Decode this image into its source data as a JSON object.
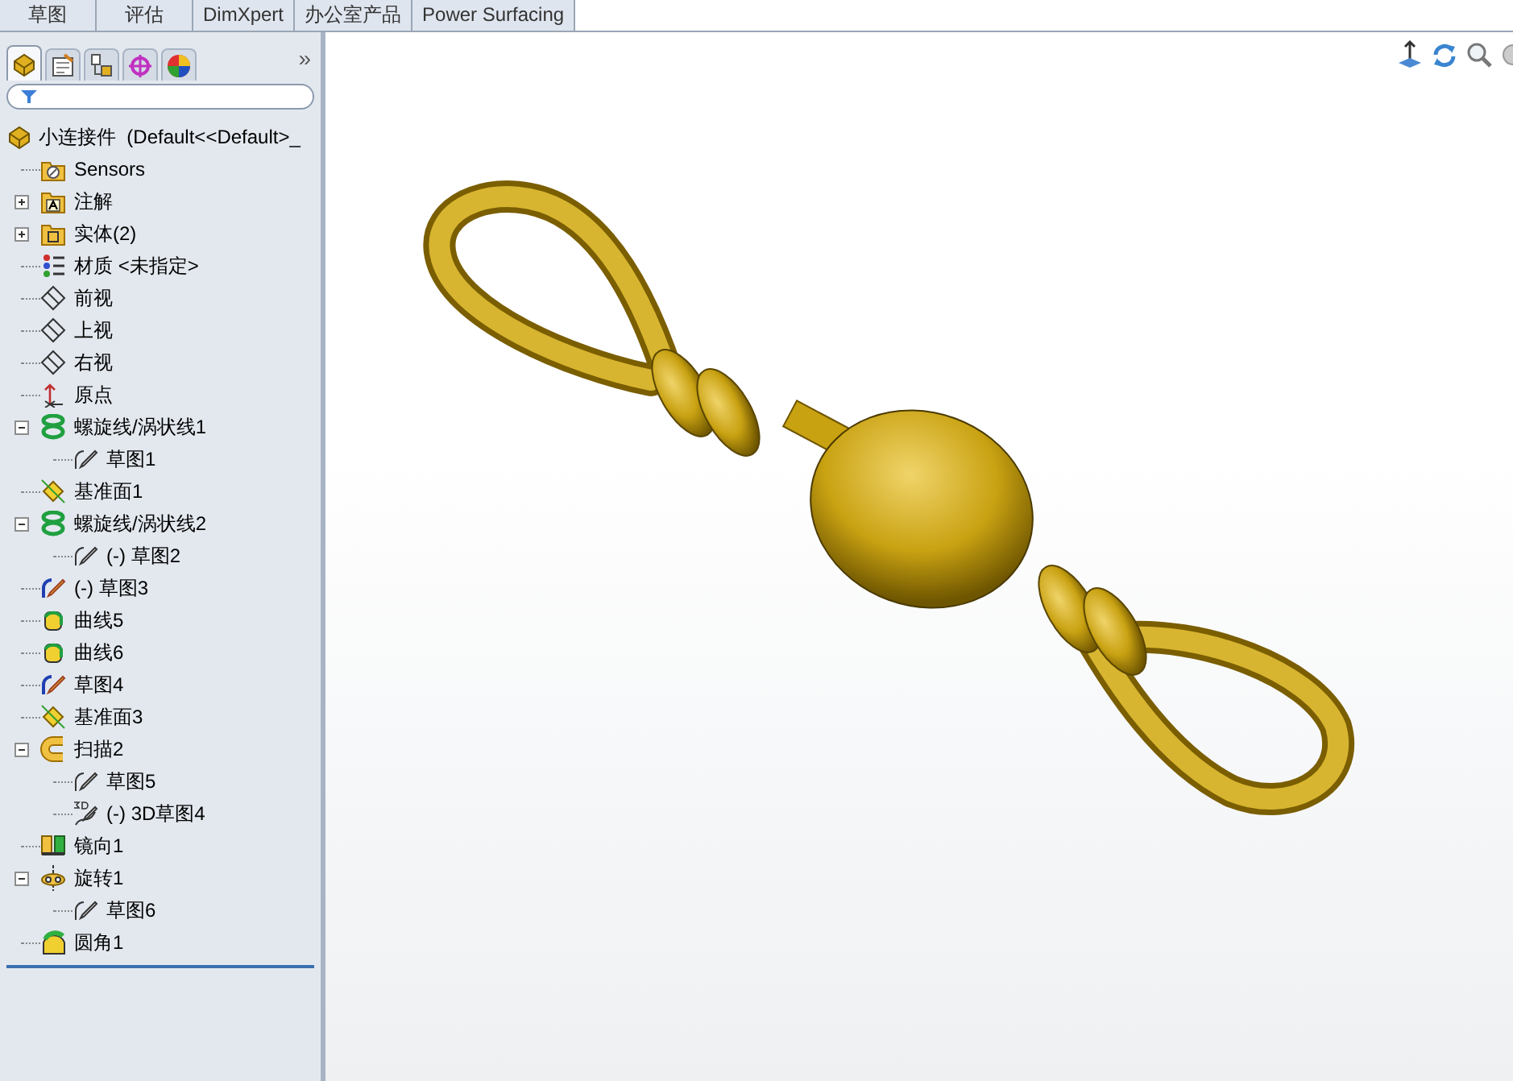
{
  "command_tabs": [
    {
      "label": "草图"
    },
    {
      "label": "评估"
    },
    {
      "label": "DimXpert"
    },
    {
      "label": "办公室产品"
    },
    {
      "label": "Power Surfacing"
    }
  ],
  "panel_tabs": [
    {
      "kind": "feature",
      "selected": true
    },
    {
      "kind": "property",
      "selected": false
    },
    {
      "kind": "config",
      "selected": false
    },
    {
      "kind": "target",
      "selected": false
    },
    {
      "kind": "appearance",
      "selected": false
    }
  ],
  "panel_more": "»",
  "tree": {
    "root": "小连接件  (Default<<Default>_",
    "items": [
      {
        "label": "Sensors",
        "kind": "sensor"
      },
      {
        "label": "注解",
        "kind": "annotation",
        "expanded": false
      },
      {
        "label": "实体(2)",
        "kind": "body",
        "expanded": false
      },
      {
        "label": "材质 <未指定>",
        "kind": "material"
      },
      {
        "label": "前视",
        "kind": "plane"
      },
      {
        "label": "上视",
        "kind": "plane"
      },
      {
        "label": "右视",
        "kind": "plane"
      },
      {
        "label": "原点",
        "kind": "origin"
      },
      {
        "label": "螺旋线/涡状线1",
        "kind": "helix",
        "expanded": true,
        "children": [
          {
            "label": "草图1",
            "kind": "sketch"
          }
        ]
      },
      {
        "label": "基准面1",
        "kind": "refplane"
      },
      {
        "label": "螺旋线/涡状线2",
        "kind": "helix",
        "expanded": true,
        "children": [
          {
            "label": "(-) 草图2",
            "kind": "sketch"
          }
        ]
      },
      {
        "label": "(-) 草图3",
        "kind": "sketch_active"
      },
      {
        "label": "曲线5",
        "kind": "curve"
      },
      {
        "label": "曲线6",
        "kind": "curve"
      },
      {
        "label": "草图4",
        "kind": "sketch_active"
      },
      {
        "label": "基准面3",
        "kind": "refplane"
      },
      {
        "label": "扫描2",
        "kind": "sweep",
        "expanded": true,
        "children": [
          {
            "label": "草图5",
            "kind": "sketch"
          },
          {
            "label": "(-) 3D草图4",
            "kind": "sketch3d"
          }
        ]
      },
      {
        "label": "镜向1",
        "kind": "mirror"
      },
      {
        "label": "旋转1",
        "kind": "revolve",
        "expanded": true,
        "children": [
          {
            "label": "草图6",
            "kind": "sketch"
          }
        ]
      },
      {
        "label": "圆角1",
        "kind": "fillet"
      }
    ]
  }
}
